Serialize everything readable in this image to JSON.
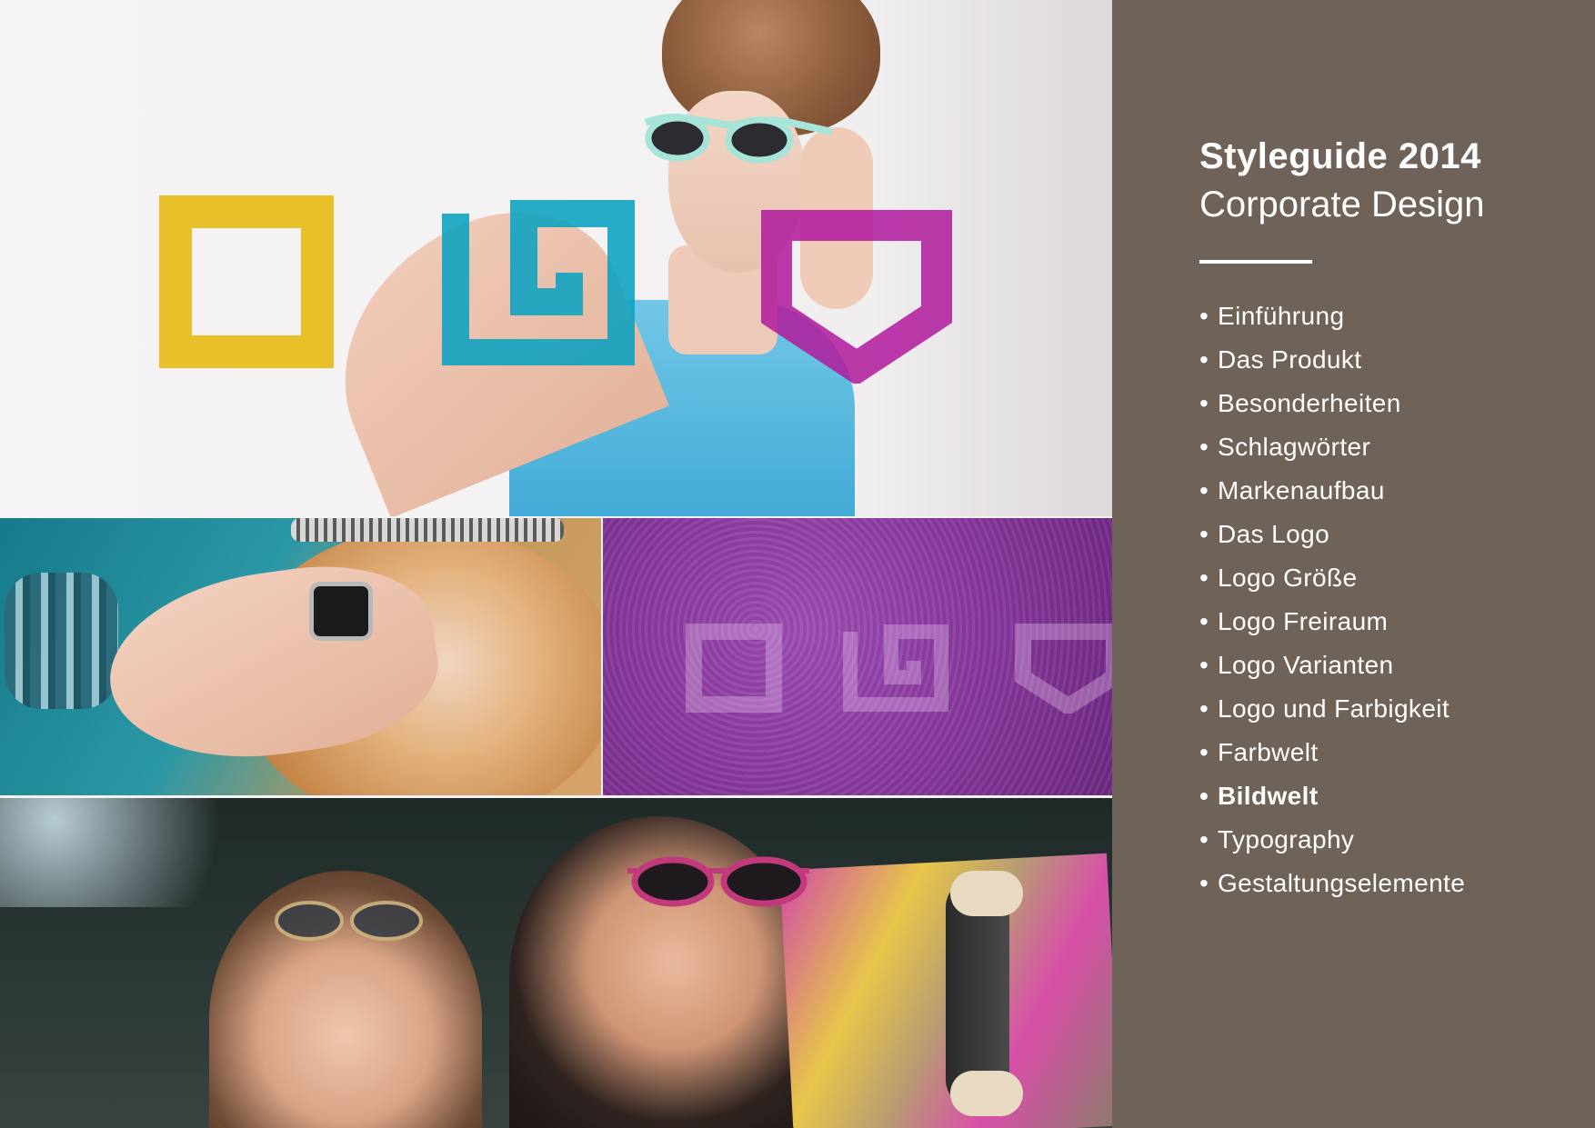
{
  "panel": {
    "title": "Styleguide 2014",
    "subtitle": "Corporate Design",
    "bullet": "•",
    "items": [
      {
        "label": "Einführung",
        "active": false
      },
      {
        "label": "Das Produkt",
        "active": false
      },
      {
        "label": "Besonderheiten",
        "active": false
      },
      {
        "label": "Schlagwörter",
        "active": false
      },
      {
        "label": "Markenaufbau",
        "active": false
      },
      {
        "label": "Das Logo",
        "active": false
      },
      {
        "label": "Logo Größe",
        "active": false
      },
      {
        "label": "Logo Freiraum",
        "active": false
      },
      {
        "label": "Logo Varianten",
        "active": false
      },
      {
        "label": "Logo und Farbigkeit",
        "active": false
      },
      {
        "label": "Farbwelt",
        "active": false
      },
      {
        "label": "Bildwelt",
        "active": true
      },
      {
        "label": "Typography",
        "active": false
      },
      {
        "label": "Gestaltungselemente",
        "active": false
      }
    ]
  },
  "colors": {
    "panel_background": "#6f6259",
    "logo_yellow": "#e8bd1f",
    "logo_cyan": "#0aa2c0",
    "logo_magenta": "#b0199c",
    "text": "#ffffff"
  },
  "images": [
    {
      "name": "hero-photo",
      "icon": "woman-with-sunglasses"
    },
    {
      "name": "teal-photo",
      "icon": "woman-with-ring-and-bracelets"
    },
    {
      "name": "purple-leather",
      "icon": "leather-texture-with-logo"
    },
    {
      "name": "bottom-photo",
      "icon": "two-women-with-skateboard"
    }
  ]
}
